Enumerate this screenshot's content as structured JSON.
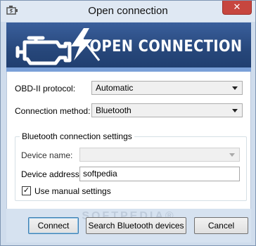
{
  "window": {
    "title": "Open connection",
    "close_glyph": "✕"
  },
  "banner": {
    "title": "OPEN CONNECTION",
    "icon": "engine-check-icon"
  },
  "form": {
    "protocol_label": "OBD-II protocol:",
    "protocol_value": "Automatic",
    "method_label": "Connection method:",
    "method_value": "Bluetooth"
  },
  "bluetooth": {
    "group_title": "Bluetooth connection settings",
    "device_name_label": "Device name:",
    "device_name_value": "",
    "device_address_label": "Device address:",
    "device_address_value": "softpedia",
    "manual_label": "Use manual settings",
    "manual_checked": "✓"
  },
  "footer": {
    "watermark": "SOFTPEDIA®",
    "connect_label": "Connect",
    "search_label": "Search Bluetooth devices",
    "cancel_label": "Cancel"
  },
  "colors": {
    "banner": "#2b4c84",
    "close": "#c7463f",
    "accent": "#3c7fb1"
  }
}
